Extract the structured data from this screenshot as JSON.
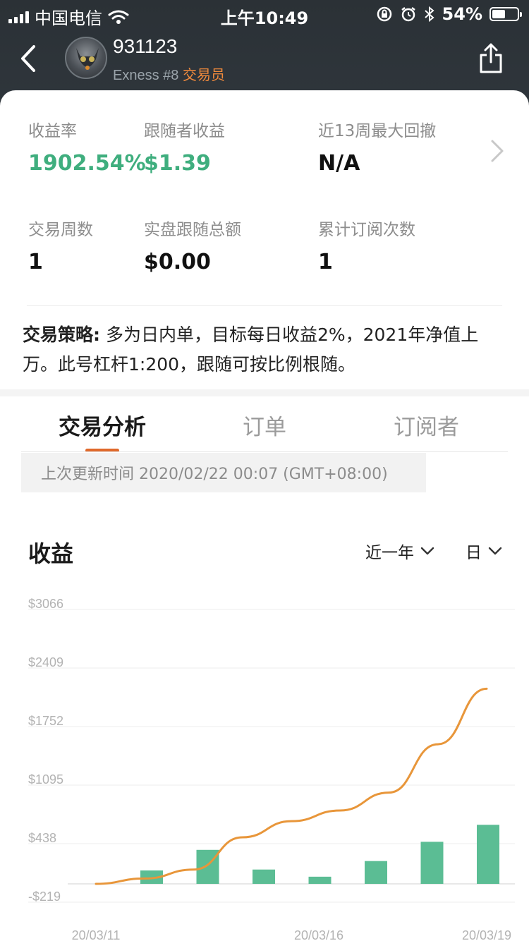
{
  "status_bar": {
    "carrier": "中国电信",
    "time": "上午10:49",
    "battery": "54%",
    "battery_level": 0.54
  },
  "header": {
    "name": "931123",
    "broker": "Exness #8",
    "role": "交易员"
  },
  "stats": {
    "return_label": "收益率",
    "return_value": "1902.54%",
    "follower_profit_label": "跟随者收益",
    "follower_profit_value": "$1.39",
    "drawdown_label": "近13周最大回撤",
    "drawdown_value": "N/A",
    "weeks_label": "交易周数",
    "weeks_value": "1",
    "follow_total_label": "实盘跟随总额",
    "follow_total_value": "$0.00",
    "subs_label": "累计订阅次数",
    "subs_value": "1"
  },
  "strategy": {
    "label": "交易策略:",
    "text": " 多为日内单，目标每日收益2%，2021年净值上万。此号杠杆1:200，跟随可按比例根随。"
  },
  "tabs": [
    "交易分析",
    "订单",
    "订阅者"
  ],
  "update": {
    "text": "上次更新时间 2020/02/22 00:07 (GMT+08:00)"
  },
  "chart_section": {
    "title": "收益",
    "period": "近一年",
    "granularity": "日"
  },
  "colors": {
    "green": "#3fae7e",
    "bar": "#5bbd94",
    "line": "#e8963a",
    "accent": "#e0692b"
  },
  "chart_data": {
    "type": "bar",
    "y_ticks": [
      "$3066",
      "$2409",
      "$1752",
      "$1095",
      "$438",
      "-$219"
    ],
    "ylim": [
      -219,
      3066
    ],
    "x_labels": [
      "20/03/11",
      "20/03/16",
      "20/03/19"
    ],
    "bars": [
      150,
      380,
      160,
      80,
      255,
      470,
      660
    ],
    "line": [
      0,
      60,
      160,
      520,
      700,
      820,
      1020,
      1560,
      2180
    ]
  }
}
